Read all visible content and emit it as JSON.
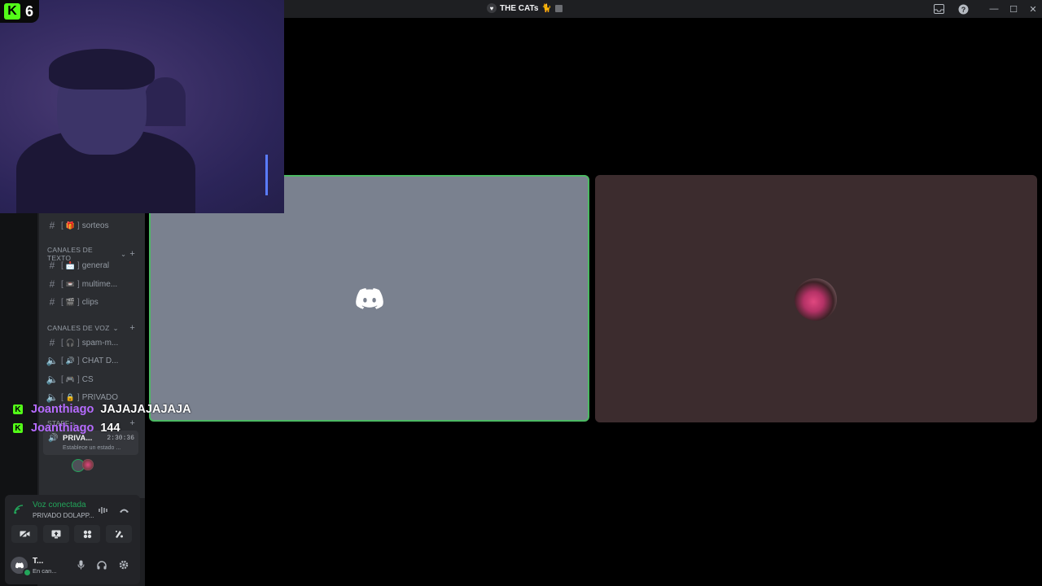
{
  "window": {
    "title": "THE CATs",
    "title_emoji": "🐈"
  },
  "kick": {
    "viewer_count": "6",
    "badge": "K"
  },
  "channels": {
    "top_channel": {
      "emoji": "🎁",
      "name": "sorteos"
    },
    "text_category": "CANALES DE TEXTO",
    "text_channels": [
      {
        "emoji": "📩",
        "name": "general"
      },
      {
        "emoji": "📼",
        "name": "multime..."
      },
      {
        "emoji": "🎬",
        "name": "clips"
      }
    ],
    "voice_category": "CANALES DE VOZ",
    "voice_channels": [
      {
        "emoji": "🎧",
        "name": "spam-m..."
      },
      {
        "emoji": "🔊",
        "name": "CHAT D..."
      },
      {
        "emoji": "🎮",
        "name": "CS"
      },
      {
        "emoji": "🔒",
        "name": "PRIVADO"
      }
    ],
    "staff_category": "STAFF",
    "active_voice": {
      "name": "PRIVA...",
      "time": "2:30:36",
      "status": "Establece un estado ..."
    }
  },
  "voice_panel": {
    "status": "Voz conectada",
    "room": "PRIVADO DOLAPP..."
  },
  "user": {
    "name": "T...",
    "sub": "En can..."
  },
  "chat_overlay": [
    {
      "user": "Joanthiago",
      "message": "JAJAJAJAJAJA"
    },
    {
      "user": "Joanthiago",
      "message": "144"
    }
  ],
  "colors": {
    "accent_green": "#53fc18",
    "voice_green": "#23a55a",
    "tile_border": "#4cb963"
  },
  "icons": [
    "discord-logo-icon",
    "inbox-icon",
    "help-icon",
    "minimize-icon",
    "maximize-icon",
    "close-icon",
    "signal-icon",
    "soundboard-icon",
    "disconnect-icon",
    "camera-off-icon",
    "screenshare-icon",
    "activities-icon",
    "soundboard-effects-icon",
    "mic-icon",
    "headphones-icon",
    "settings-icon"
  ]
}
